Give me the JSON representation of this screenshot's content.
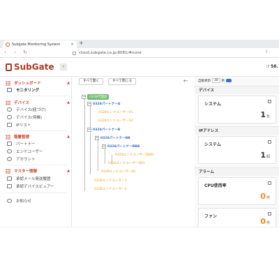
{
  "browser": {
    "tab_title": "Subgate Monitoring System",
    "url": "cloud.subgate.co.jp:8081/#none",
    "new_tab": "+"
  },
  "header": {
    "logo_text": "SubGate",
    "collapse_icon": "chevron-left-icon",
    "ip_label": "IP",
    "ip_value": "58."
  },
  "sidebar": {
    "sections": [
      {
        "label": "ダッシュボード",
        "items": [
          {
            "label": "モニタリング",
            "icon": "monitor-icon",
            "active": true
          }
        ]
      },
      {
        "label": "デバイス",
        "items": [
          {
            "label": "デバイス(紐づけ)",
            "icon": "cloud-icon"
          },
          {
            "label": "デバイス(待機)",
            "icon": "cloud-icon"
          },
          {
            "label": "IPリスト",
            "icon": "list-icon"
          }
        ]
      },
      {
        "label": "階層管理",
        "items": [
          {
            "label": "パートナー",
            "icon": "partner-icon"
          },
          {
            "label": "エンドユーザー",
            "icon": "user-icon"
          },
          {
            "label": "アカウント",
            "icon": "account-icon"
          }
        ]
      },
      {
        "label": "マスター情報",
        "items": [
          {
            "label": "承認メール発送履歴",
            "icon": "mail-icon"
          },
          {
            "label": "承認デバイスビュアー",
            "icon": "device-viewer-icon"
          }
        ]
      }
    ],
    "notice": {
      "label": "お知らせ",
      "icon": "alarm-clock-icon"
    }
  },
  "tree": {
    "expand_all": "すべて開く",
    "collapse_all": "すべて閉じる",
    "back_icon": "arrow-left-icon",
    "nodes": [
      {
        "label": "0328代理店",
        "kind": "root"
      },
      {
        "label": "0328パートナーA",
        "kind": "partner"
      },
      {
        "label": "0328エンドユーザーA1",
        "kind": "enduser"
      },
      {
        "label": "0328エンドユーザーA2",
        "kind": "enduser"
      },
      {
        "label": "0328パートナーB",
        "kind": "partner"
      },
      {
        "label": "0328パートナーBB",
        "kind": "partner"
      },
      {
        "label": "0328パートナーBBB",
        "kind": "partner"
      },
      {
        "label": "0328エンドユーザーBBB1",
        "kind": "enduser"
      },
      {
        "label": "0328エンドユーザーBB1",
        "kind": "enduser"
      },
      {
        "label": "0328エンドユーザーB1",
        "kind": "enduser"
      },
      {
        "label": "0328エンドユーザー1",
        "kind": "enduser"
      },
      {
        "label": "0328エンドユーザー2",
        "kind": "enduser"
      }
    ]
  },
  "auto_refresh": {
    "label": "自動更新",
    "value": "30",
    "unit": "秒",
    "toggle": "ON"
  },
  "panels": {
    "device": {
      "title": "デバイス",
      "card_title": "システム",
      "value": "1",
      "unit": "台"
    },
    "ip": {
      "title": "IPアドレス",
      "card_title": "システム",
      "value": "1",
      "unit": "個"
    },
    "alarm": {
      "title": "アラーム",
      "cards": [
        {
          "title": "CPU使用率",
          "value": "0",
          "unit": "件"
        },
        {
          "title": "ファン",
          "value": "0",
          "unit": "件"
        }
      ]
    }
  },
  "colors": {
    "accent": "#d0402a",
    "partner": "#3a6fcf",
    "enduser": "#f0a020",
    "root": "#6fbf6f",
    "alarm_value": "#f08a1a"
  }
}
